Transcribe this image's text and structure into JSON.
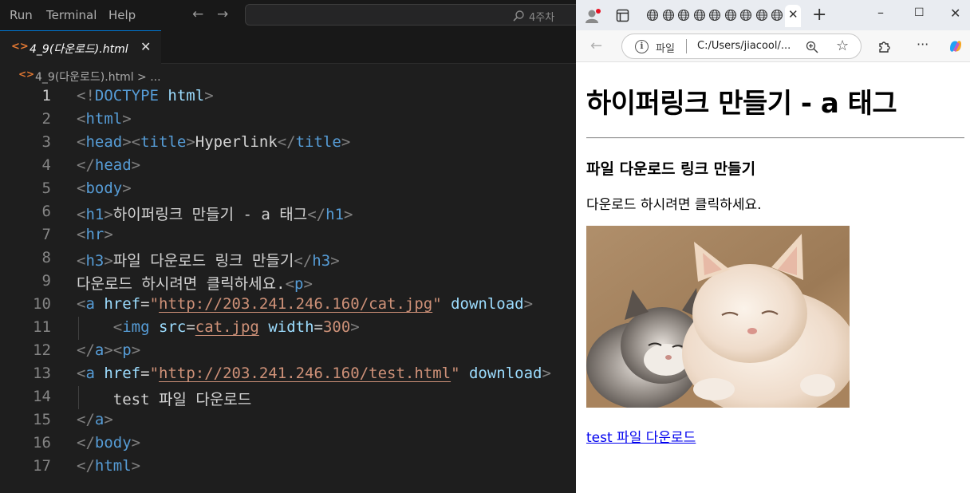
{
  "editor": {
    "menu": [
      "Run",
      "Terminal",
      "Help"
    ],
    "search_text": "4주차",
    "tab": {
      "label": "4_9(다운로드).html",
      "close": "✕"
    },
    "breadcrumb": "4_9(다운로드).html > ...",
    "lines": [
      [
        [
          "t-br",
          "<!"
        ],
        [
          "t-tag",
          "DOCTYPE"
        ],
        [
          "t-txt",
          " "
        ],
        [
          "t-attr",
          "html"
        ],
        [
          "t-br",
          ">"
        ]
      ],
      [
        [
          "t-br",
          "<"
        ],
        [
          "t-tag",
          "html"
        ],
        [
          "t-br",
          ">"
        ]
      ],
      [
        [
          "t-br",
          "<"
        ],
        [
          "t-tag",
          "head"
        ],
        [
          "t-br",
          "><"
        ],
        [
          "t-tag",
          "title"
        ],
        [
          "t-br",
          ">"
        ],
        [
          "t-txt",
          "Hyperlink"
        ],
        [
          "t-br",
          "</"
        ],
        [
          "t-tag",
          "title"
        ],
        [
          "t-br",
          ">"
        ]
      ],
      [
        [
          "t-br",
          "</"
        ],
        [
          "t-tag",
          "head"
        ],
        [
          "t-br",
          ">"
        ]
      ],
      [
        [
          "t-br",
          "<"
        ],
        [
          "t-tag",
          "body"
        ],
        [
          "t-br",
          ">"
        ]
      ],
      [
        [
          "t-br",
          "<"
        ],
        [
          "t-tag",
          "h1"
        ],
        [
          "t-br",
          ">"
        ],
        [
          "t-txt",
          "하이퍼링크 만들기 - a 태그"
        ],
        [
          "t-br",
          "</"
        ],
        [
          "t-tag",
          "h1"
        ],
        [
          "t-br",
          ">"
        ]
      ],
      [
        [
          "t-br",
          "<"
        ],
        [
          "t-tag",
          "hr"
        ],
        [
          "t-br",
          ">"
        ]
      ],
      [
        [
          "t-br",
          "<"
        ],
        [
          "t-tag",
          "h3"
        ],
        [
          "t-br",
          ">"
        ],
        [
          "t-txt",
          "파일 다운로드 링크 만들기"
        ],
        [
          "t-br",
          "</"
        ],
        [
          "t-tag",
          "h3"
        ],
        [
          "t-br",
          ">"
        ]
      ],
      [
        [
          "t-txt",
          "다운로드 하시려면 클릭하세요."
        ],
        [
          "t-br",
          "<"
        ],
        [
          "t-tag",
          "p"
        ],
        [
          "t-br",
          ">"
        ]
      ],
      [
        [
          "t-br",
          "<"
        ],
        [
          "t-tag",
          "a"
        ],
        [
          "t-txt",
          " "
        ],
        [
          "t-attr",
          "href"
        ],
        [
          "t-txt",
          "="
        ],
        [
          "t-str",
          "\""
        ],
        [
          "t-link",
          "http://203.241.246.160/cat.jpg"
        ],
        [
          "t-str",
          "\""
        ],
        [
          "t-txt",
          " "
        ],
        [
          "t-attr",
          "download"
        ],
        [
          "t-br",
          ">"
        ]
      ],
      [
        [
          "t-txt",
          "    "
        ],
        [
          "t-br",
          "<"
        ],
        [
          "t-tag",
          "img"
        ],
        [
          "t-txt",
          " "
        ],
        [
          "t-attr",
          "src"
        ],
        [
          "t-txt",
          "="
        ],
        [
          "t-link",
          "cat.jpg"
        ],
        [
          "t-txt",
          " "
        ],
        [
          "t-attr",
          "width"
        ],
        [
          "t-txt",
          "="
        ],
        [
          "t-str",
          "300"
        ],
        [
          "t-br",
          ">"
        ]
      ],
      [
        [
          "t-br",
          "</"
        ],
        [
          "t-tag",
          "a"
        ],
        [
          "t-br",
          "><"
        ],
        [
          "t-tag",
          "p"
        ],
        [
          "t-br",
          ">"
        ]
      ],
      [
        [
          "t-br",
          "<"
        ],
        [
          "t-tag",
          "a"
        ],
        [
          "t-txt",
          " "
        ],
        [
          "t-attr",
          "href"
        ],
        [
          "t-txt",
          "="
        ],
        [
          "t-str",
          "\""
        ],
        [
          "t-link",
          "http://203.241.246.160/test.html"
        ],
        [
          "t-str",
          "\""
        ],
        [
          "t-txt",
          " "
        ],
        [
          "t-attr",
          "download"
        ],
        [
          "t-br",
          ">"
        ]
      ],
      [
        [
          "t-txt",
          "    test 파일 다운로드"
        ]
      ],
      [
        [
          "t-br",
          "</"
        ],
        [
          "t-tag",
          "a"
        ],
        [
          "t-br",
          ">"
        ]
      ],
      [
        [
          "t-br",
          "</"
        ],
        [
          "t-tag",
          "body"
        ],
        [
          "t-br",
          ">"
        ]
      ],
      [
        [
          "t-br",
          "</"
        ],
        [
          "t-tag",
          "html"
        ],
        [
          "t-br",
          ">"
        ]
      ]
    ],
    "active_line": 1
  },
  "browser": {
    "scheme_label": "파일",
    "url": "C:/Users/jiacool/...",
    "page": {
      "h1": "하이퍼링크 만들기 - a 태그",
      "h3": "파일 다운로드 링크 만들기",
      "p": "다운로드 하시려면 클릭하세요.",
      "link": "test 파일 다운로드"
    }
  },
  "colors": {
    "editor_bg": "#1e1e1e",
    "tag": "#569cd6",
    "attr": "#9cdcfe",
    "string": "#ce9178",
    "accent": "#0078d4"
  }
}
